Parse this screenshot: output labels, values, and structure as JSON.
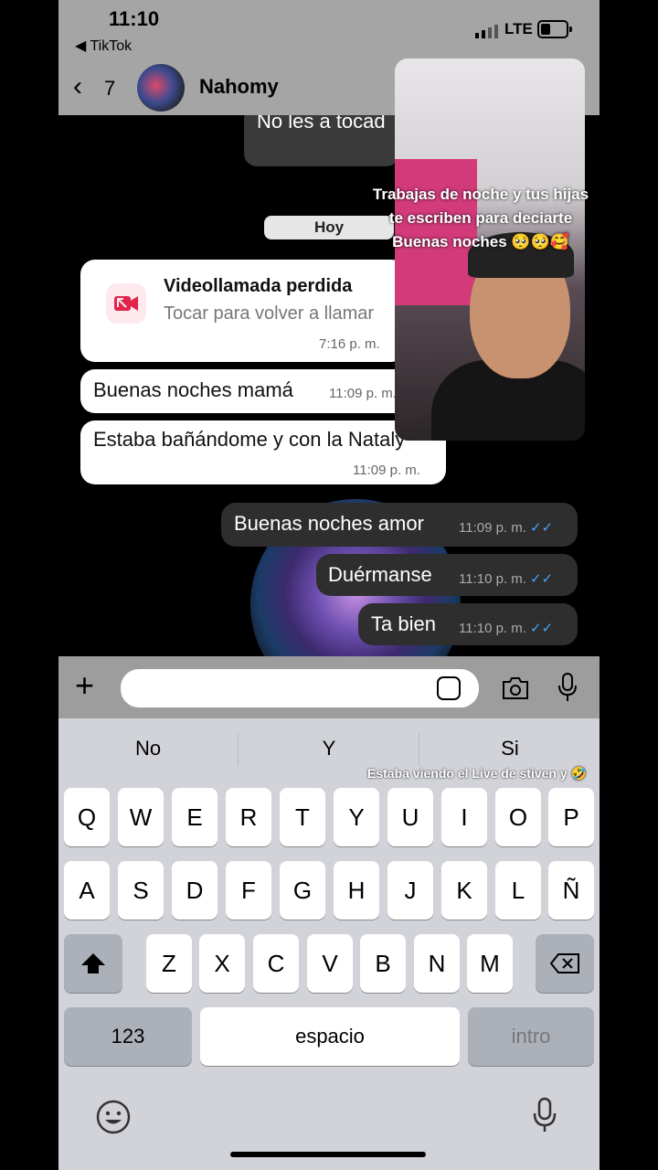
{
  "status_bar": {
    "time": "11:10",
    "back_app": "◀ TikTok",
    "network": "LTE"
  },
  "header": {
    "back_count": "7",
    "contact_name": "Nahomy"
  },
  "chat": {
    "quoted_partial": "No les a tocad",
    "day_separator": "Hoy",
    "missed_call": {
      "title": "Videollamada perdida",
      "subtitle": "Tocar para volver a llamar",
      "time": "7:16 p. m."
    },
    "incoming": [
      {
        "text": "Buenas noches mamá",
        "time": "11:09 p. m."
      },
      {
        "text": "Estaba bañándome y con la Nataly",
        "time": "11:09 p. m."
      }
    ],
    "outgoing": [
      {
        "text": "Buenas noches amor",
        "time": "11:09 p. m."
      },
      {
        "text": "Duérmanse",
        "time": "11:10 p. m."
      },
      {
        "text": "Ta bien",
        "time": "11:10 p. m."
      }
    ]
  },
  "overlay": {
    "caption": "Trabajas de noche y tus hijas te escriben para deciarte Buenas noches 🥺🥺🥰",
    "caption2": "Estaba viendo el Live de stiven y 🤣"
  },
  "composer": {
    "placeholder": ""
  },
  "keyboard": {
    "suggestions": [
      "No",
      "Y",
      "Si"
    ],
    "row1": [
      "Q",
      "W",
      "E",
      "R",
      "T",
      "Y",
      "U",
      "I",
      "O",
      "P"
    ],
    "row2": [
      "A",
      "S",
      "D",
      "F",
      "G",
      "H",
      "J",
      "K",
      "L",
      "Ñ"
    ],
    "row3": [
      "Z",
      "X",
      "C",
      "V",
      "B",
      "N",
      "M"
    ],
    "numbers_key": "123",
    "space_key": "espacio",
    "return_key": "intro"
  },
  "colors": {
    "tick_blue": "#4aa3f5",
    "missed_call_red": "#e0244a"
  }
}
